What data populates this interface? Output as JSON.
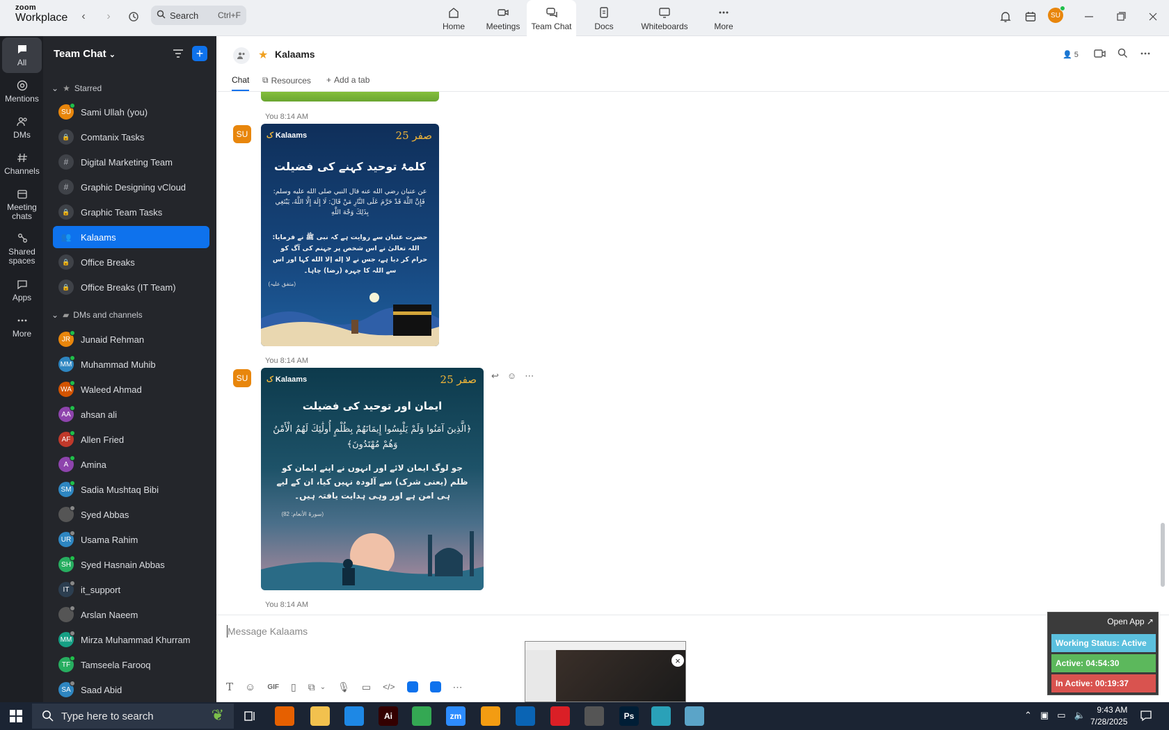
{
  "top": {
    "logo_line1": "zoom",
    "logo_line2": "Workplace",
    "search_placeholder": "Search",
    "search_shortcut": "Ctrl+F",
    "nav": [
      {
        "label": "Home",
        "icon": "home-icon"
      },
      {
        "label": "Meetings",
        "icon": "video-icon"
      },
      {
        "label": "Team Chat",
        "icon": "chat-icon"
      },
      {
        "label": "Docs",
        "icon": "doc-icon"
      },
      {
        "label": "Whiteboards",
        "icon": "whiteboard-icon"
      },
      {
        "label": "More",
        "icon": "more-icon"
      }
    ],
    "avatar": "SU"
  },
  "rail": [
    {
      "label": "All",
      "icon": "chat-bubble-icon"
    },
    {
      "label": "Mentions",
      "icon": "at-icon"
    },
    {
      "label": "DMs",
      "icon": "people-icon"
    },
    {
      "label": "Channels",
      "icon": "hash-icon"
    },
    {
      "label": "Meeting chats",
      "icon": "calendar-icon"
    },
    {
      "label": "Shared spaces",
      "icon": "shared-icon"
    },
    {
      "label": "Apps",
      "icon": "apps-icon"
    },
    {
      "label": "More",
      "icon": "more-icon"
    }
  ],
  "sidebar": {
    "title": "Team Chat",
    "starred_label": "Starred",
    "dms_label": "DMs and channels",
    "starred": [
      {
        "name": "Sami Ullah (you)",
        "kind": "avatar",
        "initials": "SU",
        "color": "#e8860c",
        "status": "#1fbf4a"
      },
      {
        "name": "Comtanix Tasks",
        "kind": "lock"
      },
      {
        "name": "Digital Marketing Team",
        "kind": "hash"
      },
      {
        "name": "Graphic Designing vCloud",
        "kind": "hash"
      },
      {
        "name": "Graphic Team Tasks",
        "kind": "lock"
      },
      {
        "name": "Kalaams",
        "kind": "group",
        "active": true
      },
      {
        "name": "Office Breaks",
        "kind": "lock"
      },
      {
        "name": "Office Breaks (IT Team)",
        "kind": "lock"
      }
    ],
    "dms": [
      {
        "name": "Junaid Rehman",
        "initials": "JR",
        "color": "#e8860c",
        "status": "#1fbf4a"
      },
      {
        "name": "Muhammad Muhib",
        "initials": "MM",
        "color": "#2e86c1",
        "status": "#1fbf4a"
      },
      {
        "name": "Waleed Ahmad",
        "initials": "WA",
        "color": "#d35400",
        "status": "#1fbf4a"
      },
      {
        "name": "ahsan ali",
        "initials": "AA",
        "color": "#8e44ad",
        "status": "#1fbf4a"
      },
      {
        "name": "Allen Fried",
        "initials": "AF",
        "color": "#c0392b",
        "status": "#1fbf4a"
      },
      {
        "name": "Amina",
        "initials": "A",
        "color": "#8e44ad",
        "status": "#1fbf4a"
      },
      {
        "name": "Sadia Mushtaq Bibi",
        "initials": "SM",
        "color": "#2e86c1",
        "status": "#1fbf4a"
      },
      {
        "name": "Syed Abbas",
        "initials": "",
        "color": "#555",
        "status": "#888"
      },
      {
        "name": "Usama Rahim",
        "initials": "UR",
        "color": "#2e86c1",
        "status": "#888"
      },
      {
        "name": "Syed Hasnain Abbas",
        "initials": "SH",
        "color": "#27ae60",
        "status": "#1fbf4a"
      },
      {
        "name": "it_support",
        "initials": "IT",
        "color": "#2c3e50",
        "status": "#888"
      },
      {
        "name": "Arslan Naeem",
        "initials": "",
        "color": "#555",
        "status": "#888"
      },
      {
        "name": "Mirza Muhammad Khurram",
        "initials": "MM",
        "color": "#16a085",
        "status": "#888"
      },
      {
        "name": "Tamseela Farooq",
        "initials": "TF",
        "color": "#27ae60",
        "status": "#1fbf4a"
      },
      {
        "name": "Saad Abid",
        "initials": "SA",
        "color": "#2e86c1",
        "status": "#888"
      }
    ]
  },
  "chat": {
    "title": "Kalaams",
    "member_count": "5",
    "tabs": [
      "Chat",
      "Resources",
      "Add a tab"
    ],
    "messages": [
      {
        "time": "You 8:14 AM",
        "avatar": "SU",
        "brand": "Kalaams",
        "mark": "صفر 25",
        "title": "کلمۂ توحید کہنے کی فضیلت",
        "arabic": "عن عتبان رضي الله عنه قال النبي صلى الله عليه وسلم: فَإِنَّ اللَّهَ قَدْ حَرَّمَ عَلَى النَّارِ مَنْ قَالَ: لَا إِلَهَ إِلَّا اللَّهُ، يَبْتَغِي بِذَلِكَ وَجْهَ اللَّهِ",
        "urdu": "حضرت عتبان سے روایت ہے کہ نبی ﷺ نے فرمایا: اللہ تعالیٰ نے اس شخص پر جہنم کی آگ کو حرام کر دیا ہے، جس نے لا إله إلا الله کہا اور اس سے اللہ کا چہرہ (رضا) چاہا۔",
        "ref": "(متفق علیہ)"
      },
      {
        "time": "You 8:14 AM",
        "avatar": "SU",
        "brand": "Kalaams",
        "mark": "صفر 25",
        "title": "ایمان اور توحید کی فضیلت",
        "arabic": "﴿الَّذِينَ آمَنُوا وَلَمْ يَلْبِسُوا إِيمَانَهُمْ بِظُلْمٍ أُولَٰئِكَ لَهُمُ الْأَمْنُ وَهُمْ مُهْتَدُونَ﴾",
        "urdu": "جو لوگ ایمان لائے اور انہوں نے اپنے ایمان کو ظلم (یعنی شرک) سے آلودہ نہیں کیا، ان کے لیے ہی امن ہے اور وہی ہدایت یافتہ ہیں۔",
        "ref": "(سورۃ الأنعام: 82)"
      },
      {
        "time": "You 8:14 AM"
      }
    ],
    "composer_placeholder": "Message Kalaams"
  },
  "widget": {
    "open_app": "Open App ↗",
    "status": "Working Status: Active",
    "active": "Active: 04:54:30",
    "inactive": "In Active: 00:19:37",
    "colors": {
      "status": "#5bc0de",
      "active": "#5cb85c",
      "inactive": "#d9534f"
    }
  },
  "taskbar": {
    "search": "Type here to search",
    "time": "9:43 AM",
    "date": "7/28/2025",
    "apps": [
      {
        "name": "firefox-icon",
        "label": "",
        "color": "#e66000"
      },
      {
        "name": "file-explorer-icon",
        "label": "",
        "color": "#f2c14e"
      },
      {
        "name": "vscode-icon",
        "label": "",
        "color": "#1e88e5"
      },
      {
        "name": "illustrator-icon",
        "label": "Ai",
        "color": "#330000"
      },
      {
        "name": "chrome-icon",
        "label": "",
        "color": "#34a853"
      },
      {
        "name": "zoom-icon",
        "label": "zm",
        "color": "#2d8cff"
      },
      {
        "name": "app-icon",
        "label": "",
        "color": "#f39c12"
      },
      {
        "name": "outlook-icon",
        "label": "",
        "color": "#0a64b4"
      },
      {
        "name": "creative-cloud-icon",
        "label": "",
        "color": "#da1f26"
      },
      {
        "name": "pen-icon",
        "label": "",
        "color": "#555"
      },
      {
        "name": "photoshop-icon",
        "label": "Ps",
        "color": "#001e36"
      },
      {
        "name": "vpn-icon",
        "label": "",
        "color": "#2aa1b8"
      },
      {
        "name": "notes-icon",
        "label": "",
        "color": "#5ba4c8"
      }
    ]
  }
}
